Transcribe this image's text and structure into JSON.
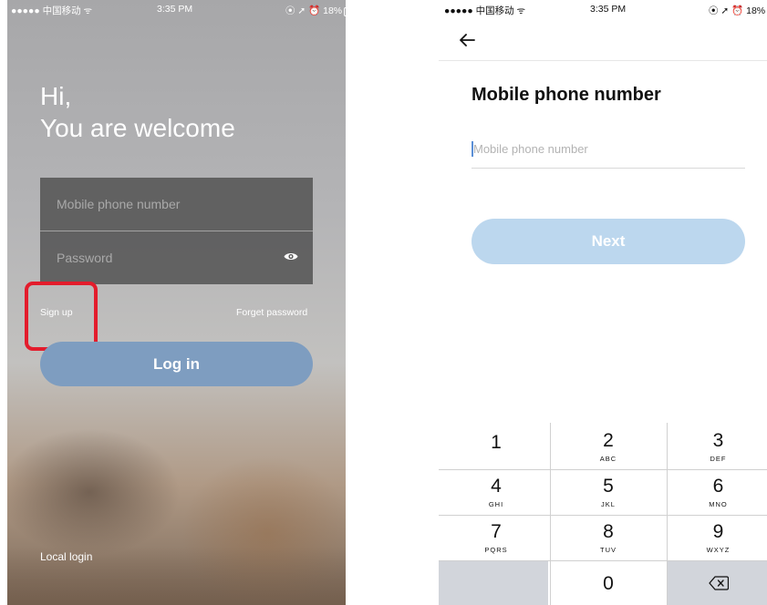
{
  "left_screen": {
    "status_bar": {
      "carrier": "●●●●● 中国移动 ᯤ",
      "time": "3:35 PM",
      "battery_text": "⦿ ➚ ⏰ 18%"
    },
    "greeting_line1": "Hi,",
    "greeting_line2": "You are welcome",
    "phone_field_placeholder": "Mobile phone number",
    "password_field_placeholder": "Password",
    "sign_up_label": "Sign up",
    "forget_password_label": "Forget password",
    "login_button_label": "Log in",
    "local_login_label": "Local login",
    "highlight_color": "#e31c2c",
    "button_color": "#7e9dc0"
  },
  "right_screen": {
    "status_bar": {
      "carrier": "●●●●● 中国移动 ᯤ",
      "time": "3:35 PM",
      "battery_text": "⦿ ➚ ⏰ 18%"
    },
    "back_icon": "arrow-left-icon",
    "title": "Mobile phone number",
    "input_placeholder": "Mobile phone number",
    "next_button_label": "Next",
    "next_button_color": "#bcd7ee",
    "keypad": {
      "keys": [
        {
          "num": "1",
          "letters": ""
        },
        {
          "num": "2",
          "letters": "ABC"
        },
        {
          "num": "3",
          "letters": "DEF"
        },
        {
          "num": "4",
          "letters": "GHI"
        },
        {
          "num": "5",
          "letters": "JKL"
        },
        {
          "num": "6",
          "letters": "MNO"
        },
        {
          "num": "7",
          "letters": "PQRS"
        },
        {
          "num": "8",
          "letters": "TUV"
        },
        {
          "num": "9",
          "letters": "WXYZ"
        },
        {
          "num": "0",
          "letters": ""
        }
      ],
      "delete_icon": "backspace-icon"
    }
  }
}
